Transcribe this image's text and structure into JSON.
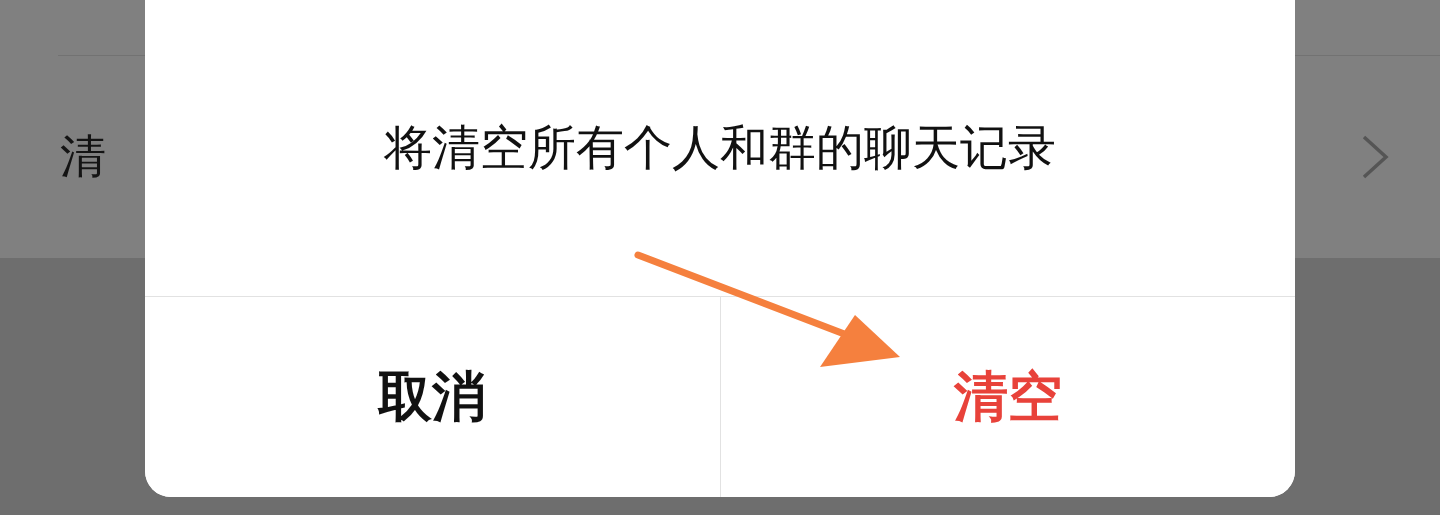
{
  "background": {
    "row": {
      "label": "清"
    }
  },
  "dialog": {
    "message": "将清空所有个人和群的聊天记录",
    "buttons": [
      {
        "label": "取消",
        "kind": "cancel"
      },
      {
        "label": "清空",
        "kind": "destructive"
      }
    ]
  }
}
